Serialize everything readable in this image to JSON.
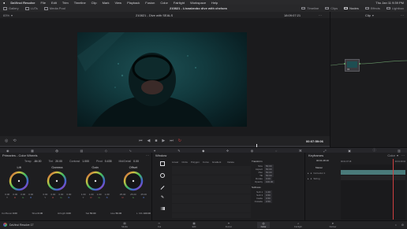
{
  "menubar": {
    "items": [
      "DaVinci Resolve",
      "File",
      "Edit",
      "Trim",
      "Timeline",
      "Clip",
      "Mark",
      "View",
      "Playback",
      "Fusion",
      "Color",
      "Fairlight",
      "Workspace",
      "Help"
    ],
    "clock": "Thu Jan 11 9:39 PM"
  },
  "toolbar": {
    "gallery": "Gallery",
    "luts": "LUTs",
    "media_pool": "Media Pool",
    "title": "210821 - Lisnabrobo dive with chelsea",
    "timeline_btn": "Timeline",
    "clips_btn": "Clips",
    "nodes_btn": "Nodes",
    "effects_btn": "Effects",
    "lightbox_btn": "Lightbox"
  },
  "viewer": {
    "zoom": "83%",
    "clip_name": "210821 - Dive with SEALS",
    "timecode": "18:09:07:21",
    "playhead_tc": "00:07:59:06"
  },
  "node_editor": {
    "mode": "Clip",
    "node_label": "01"
  },
  "color_wheels": {
    "panel": "Primaries - Color Wheels",
    "temp_label": "Temp",
    "temp": "-84.00",
    "tint_label": "Tint",
    "tint": "20.00",
    "contrast_label": "Contrast",
    "contrast": "1.000",
    "pivot_label": "Pivot",
    "pivot": "0.435",
    "middetail_label": "Mid/Detail",
    "middetail": "0.00",
    "wheels": [
      {
        "name": "Lift",
        "values": [
          "0.00",
          "0.00",
          "0.00",
          "0.00"
        ],
        "labels": [
          "Y",
          "R",
          "G",
          "B"
        ]
      },
      {
        "name": "Gamma",
        "values": [
          "0.00",
          "0.00",
          "0.00",
          "0.00"
        ],
        "labels": [
          "Y",
          "R",
          "G",
          "B"
        ]
      },
      {
        "name": "Gain",
        "values": [
          "1.00",
          "1.00",
          "1.00",
          "1.00"
        ],
        "labels": [
          "Y",
          "R",
          "G",
          "B"
        ]
      },
      {
        "name": "Offset",
        "values": [
          "25.00",
          "25.00",
          "25.00",
          "25.00"
        ],
        "labels": [
          "R",
          "G",
          "B",
          ""
        ]
      }
    ],
    "bottom": [
      {
        "l": "Col Boost",
        "v": "0.00"
      },
      {
        "l": "Shad",
        "v": "0.00"
      },
      {
        "l": "Hi/Light",
        "v": "0.00"
      },
      {
        "l": "Sat",
        "v": "50.00"
      },
      {
        "l": "Hue",
        "v": "50.00"
      },
      {
        "l": "L. Mix",
        "v": "100.00"
      }
    ]
  },
  "window": {
    "title": "Window",
    "tools": [
      "Linear",
      "Circle",
      "Polygon",
      "Curve",
      "Gradient"
    ],
    "delete": "Delete",
    "transform": "Transform",
    "softness": "Softness",
    "transform_labels": [
      "Size",
      "Aspect",
      "Pan",
      "Tilt",
      "Rotate",
      "Opacity"
    ],
    "transform_values": [
      "50.00",
      "50.00",
      "50.00",
      "50.00",
      "0.00",
      "100.00"
    ],
    "softness_labels": [
      "Soft 1",
      "Soft 3",
      "Inside",
      "Outside"
    ],
    "softness_values": [
      "1.00",
      "0.50",
      "0.50",
      "0.50"
    ]
  },
  "keyframes": {
    "title": "Keyframes",
    "mode": "Color",
    "timecode": "00:01:28:19",
    "tracks": [
      "Master",
      "Corrector 1",
      "Sizing"
    ],
    "ruler": [
      "00:01:07:18",
      "00:01:29:04"
    ]
  },
  "statusbar": {
    "app": "DaVinci Resolve 17",
    "pages": [
      "Media",
      "Cut",
      "Edit",
      "Fusion",
      "Color",
      "Fairlight",
      "Deliver"
    ],
    "active": 4
  }
}
